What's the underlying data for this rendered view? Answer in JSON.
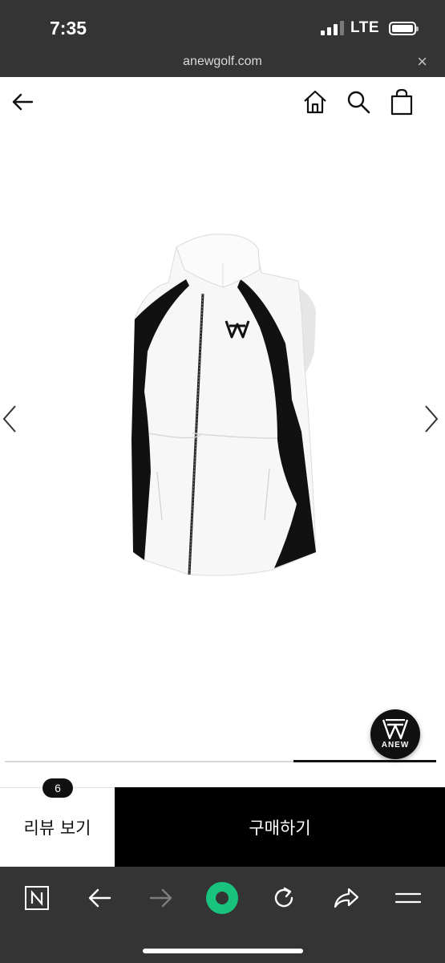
{
  "status_bar": {
    "time": "7:35",
    "network": "LTE"
  },
  "browser": {
    "url": "anewgolf.com",
    "close_symbol": "×"
  },
  "header": {
    "back_icon": "arrow-left-icon",
    "icons": [
      "home-icon",
      "search-icon",
      "shopping-bag-icon"
    ]
  },
  "product": {
    "image": "white-black-golf-vest",
    "logo_badge_text": "ANEW",
    "carousel_progress_percent": 33
  },
  "actions": {
    "review_label": "리뷰 보기",
    "review_count": "6",
    "buy_label": "구매하기"
  },
  "toolbar": {
    "icons": [
      "naver-n-icon",
      "back-icon",
      "forward-icon",
      "green-circle-icon",
      "reload-icon",
      "share-icon",
      "menu-icon"
    ],
    "accent_color": "#19c37d"
  },
  "colors": {
    "chrome": "#343434",
    "buy_button": "#000000"
  }
}
